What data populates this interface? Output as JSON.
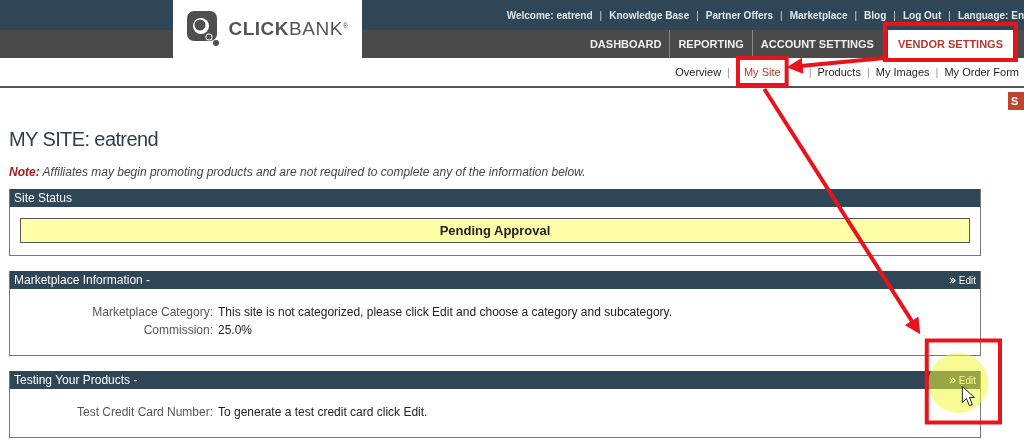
{
  "top_links": [
    {
      "kind": "link",
      "label": "Welcome: eatrend"
    },
    {
      "kind": "separator",
      "label": "|"
    },
    {
      "kind": "link",
      "label": "Knowledge Base"
    },
    {
      "kind": "separator",
      "label": "|"
    },
    {
      "kind": "link",
      "label": "Partner Offers"
    },
    {
      "kind": "separator",
      "label": "|"
    },
    {
      "kind": "link",
      "label": "Marketplace"
    },
    {
      "kind": "separator",
      "label": "|"
    },
    {
      "kind": "link",
      "label": "Blog"
    },
    {
      "kind": "separator",
      "label": "|"
    },
    {
      "kind": "link",
      "label": "Log Out"
    },
    {
      "kind": "separator",
      "label": "|"
    },
    {
      "kind": "link",
      "label": "Language: En"
    }
  ],
  "logo": {
    "text": "**CLICK**BANK$^{®}$"
  },
  "main_nav": [
    {
      "label": "DASHBOARD",
      "selected": false
    },
    {
      "label": "REPORTING",
      "selected": false
    },
    {
      "label": "ACCOUNT SETTINGS",
      "selected": false
    },
    {
      "label": "VENDOR SETTINGS",
      "selected": true
    }
  ],
  "sub_nav": [
    {
      "kind": "link",
      "label": "Overview",
      "selected": false
    },
    {
      "kind": "separator",
      "label": "|"
    },
    {
      "kind": "link",
      "label": "My Site",
      "selected": true
    },
    {
      "kind": "separator",
      "label": "|"
    },
    {
      "kind": "link",
      "label": "Products",
      "selected": false
    },
    {
      "kind": "separator",
      "label": "|"
    },
    {
      "kind": "link",
      "label": "My Images",
      "selected": false
    },
    {
      "kind": "separator",
      "label": "|"
    },
    {
      "kind": "link",
      "label": "My Order Form",
      "selected": false
    }
  ],
  "side_tab": {
    "label": "S"
  },
  "page_title": "MY SITE: eatrend",
  "note": "**Note:** Affiliates may begin promoting products and are not required to complete any of the information below.",
  "panels": [
    {
      "title": "Site Status",
      "status": "Pending Approval"
    },
    {
      "title": "Marketplace Information -",
      "edit_link": "Edit",
      "fields": [
        {
          "label": "Marketplace Category:",
          "value": "This site is not categorized, please click Edit and choose a category and subcategory."
        },
        {
          "label": "Commission:",
          "value": "25.0%"
        }
      ]
    },
    {
      "title": "Testing Your Products -",
      "edit_link": "Edit",
      "fields": [
        {
          "label": "Test Credit Card Number:",
          "value": "To generate a test credit card click Edit."
        }
      ]
    }
  ]
}
